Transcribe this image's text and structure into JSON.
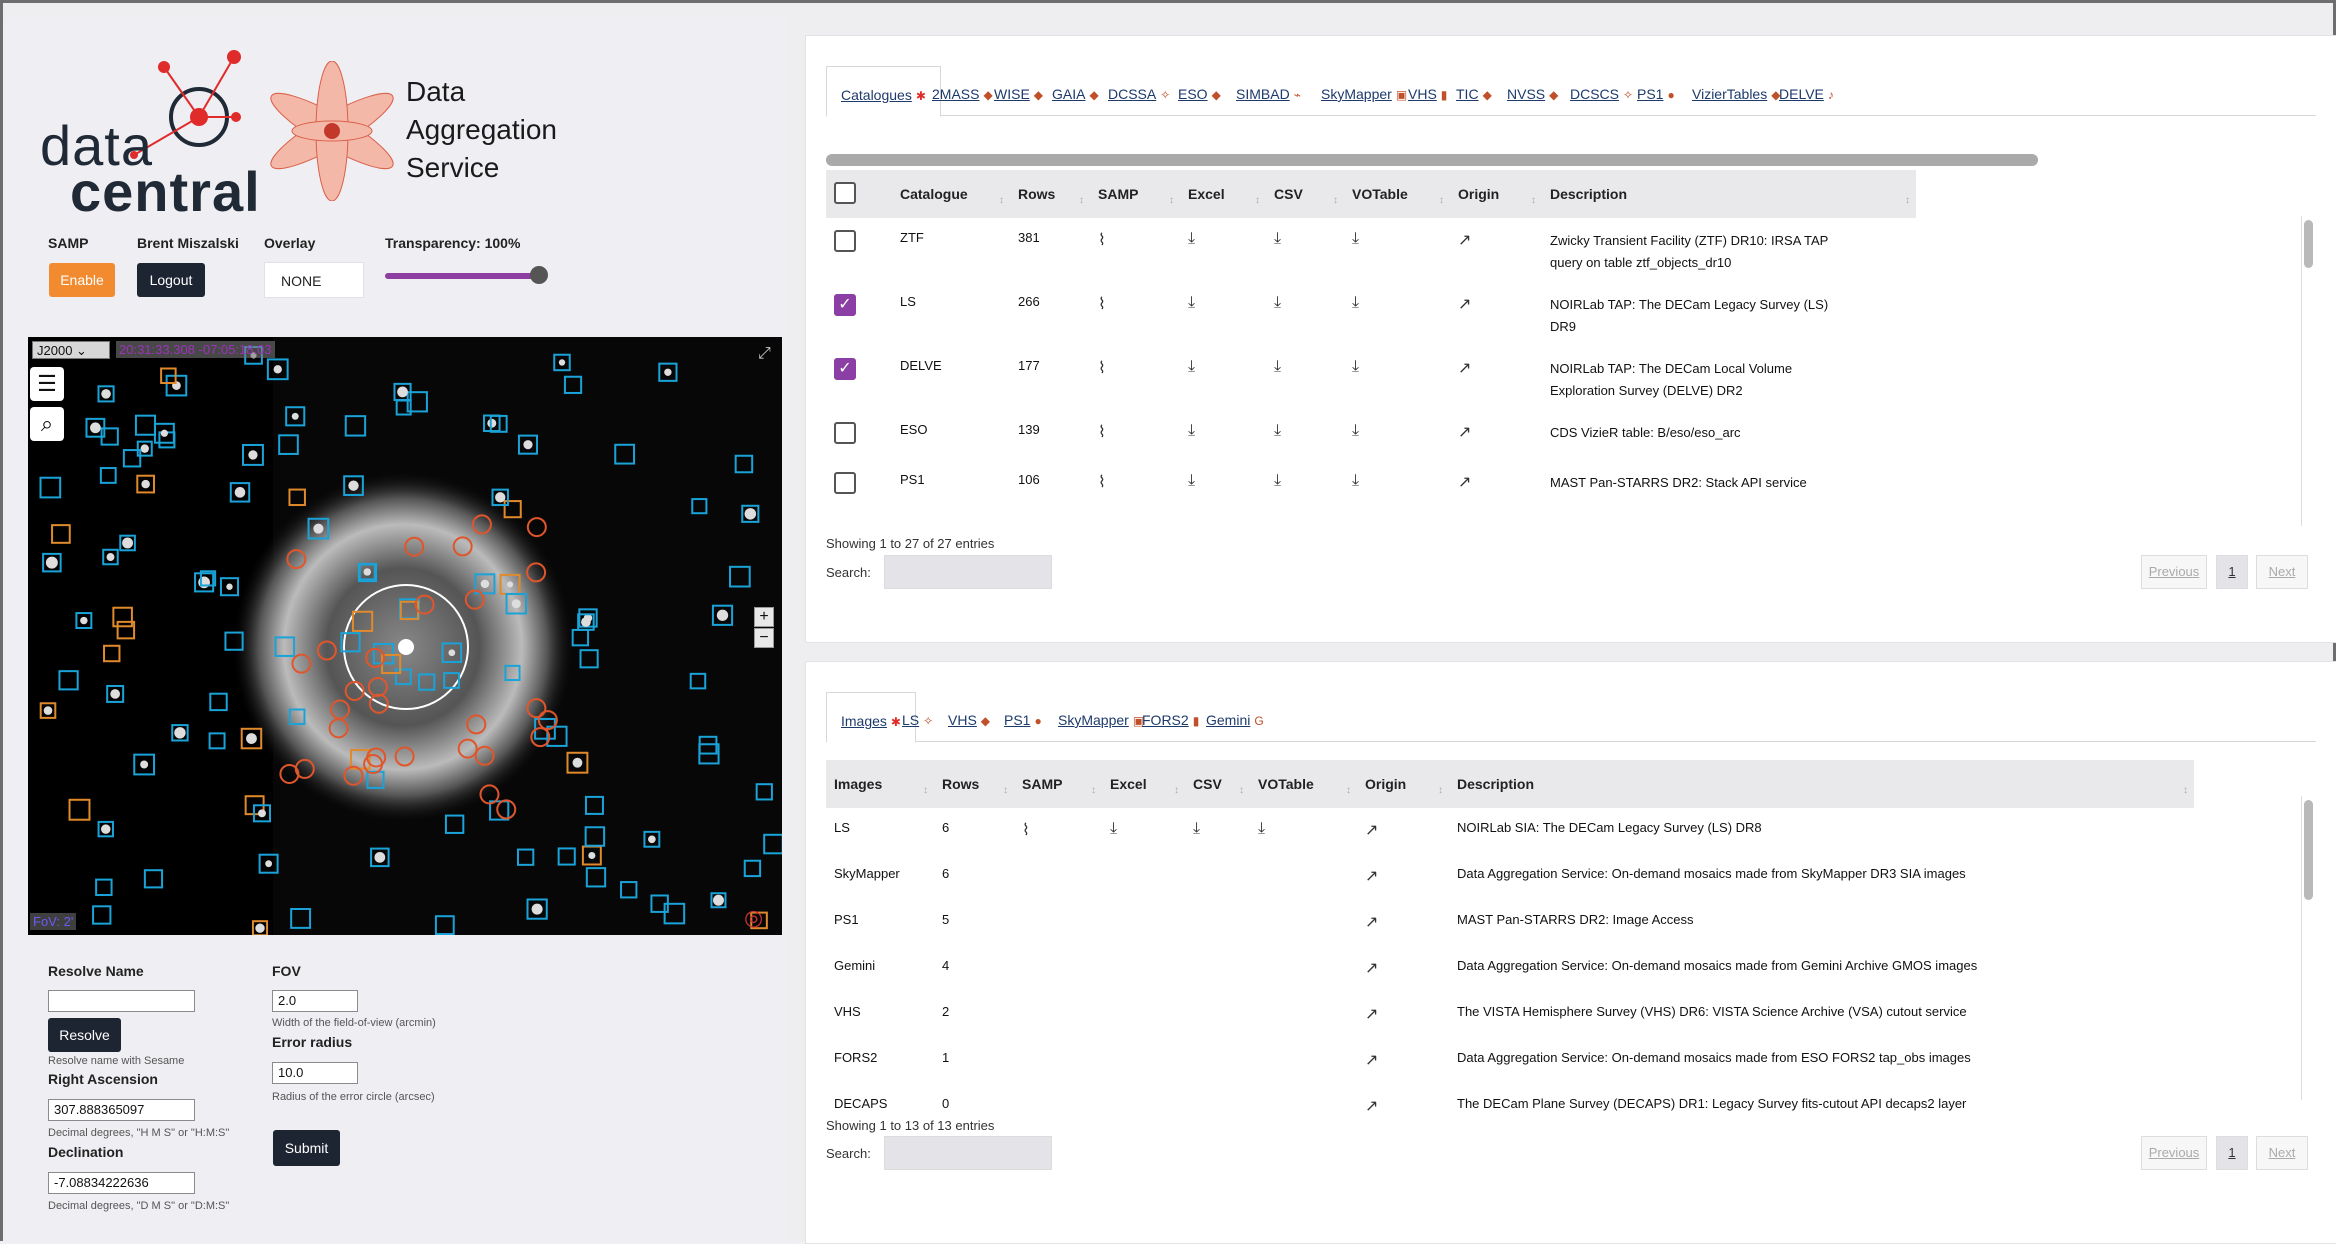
{
  "brand": {
    "logo_word1": "data",
    "logo_word2": "central",
    "service_line1": "Data",
    "service_line2": "Aggregation",
    "service_line3": "Service"
  },
  "controls": {
    "samp_label": "SAMP",
    "samp_button": "Enable",
    "user_name": "Brent Miszalski",
    "logout_button": "Logout",
    "overlay_label": "Overlay",
    "overlay_value": "NONE",
    "transparency_label": "Transparency: 100%",
    "transparency_value": 1.0
  },
  "sky": {
    "frame": "J2000",
    "coord_readout": "20:31:33.308 -07:05:18.03",
    "fov_readout": "FoV: 2'"
  },
  "form": {
    "resolve_label": "Resolve Name",
    "resolve_value": "",
    "resolve_button": "Resolve",
    "resolve_help": "Resolve name with Sesame",
    "ra_label": "Right Ascension",
    "ra_value": "307.888365097",
    "ra_help": "Decimal degrees, \"H M S\" or \"H:M:S\"",
    "dec_label": "Declination",
    "dec_value": "-7.08834222636",
    "dec_help": "Decimal degrees, \"D M S\" or \"D:M:S\"",
    "fov_label": "FOV",
    "fov_value": "2.0",
    "fov_help": "Width of the field-of-view (arcmin)",
    "err_label": "Error radius",
    "err_value": "10.0",
    "err_help": "Radius of the error circle (arcsec)",
    "submit_button": "Submit"
  },
  "catalogues": {
    "tabs": [
      "Catalogues",
      "2MASS",
      "WISE",
      "GAIA",
      "DCSSA",
      "ESO",
      "SIMBAD",
      "SkyMapper",
      "VHS",
      "TIC",
      "NVSS",
      "DCSCS",
      "PS1",
      "VizierTables",
      "DELVE"
    ],
    "columns": [
      "Catalogue",
      "Rows",
      "SAMP",
      "Excel",
      "CSV",
      "VOTable",
      "Origin",
      "Description"
    ],
    "rows": [
      {
        "checked": false,
        "name": "ZTF",
        "rows": "381",
        "desc1": "Zwicky Transient Facility (ZTF) DR10: IRSA TAP",
        "desc2": "query on table ztf_objects_dr10"
      },
      {
        "checked": true,
        "name": "LS",
        "rows": "266",
        "desc1": "NOIRLab TAP: The DECam Legacy Survey (LS)",
        "desc2": "DR9"
      },
      {
        "checked": true,
        "name": "DELVE",
        "rows": "177",
        "desc1": "NOIRLab TAP: The DECam Local Volume",
        "desc2": "Exploration Survey (DELVE) DR2"
      },
      {
        "checked": false,
        "name": "ESO",
        "rows": "139",
        "desc1": "CDS VizieR table: B/eso/eso_arc",
        "desc2": ""
      },
      {
        "checked": false,
        "name": "PS1",
        "rows": "106",
        "desc1": "MAST Pan-STARRS DR2: Stack API service",
        "desc2": ""
      }
    ],
    "info": "Showing 1 to 27 of 27 entries",
    "search_label": "Search:",
    "prev": "Previous",
    "page": "1",
    "next": "Next"
  },
  "images": {
    "tabs": [
      "Images",
      "LS",
      "VHS",
      "PS1",
      "SkyMapper",
      "FORS2",
      "Gemini"
    ],
    "columns": [
      "Images",
      "Rows",
      "SAMP",
      "Excel",
      "CSV",
      "VOTable",
      "Origin",
      "Description"
    ],
    "rows": [
      {
        "name": "LS",
        "rows": "6",
        "samp": true,
        "desc": "NOIRLab SIA: The DECam Legacy Survey (LS) DR8"
      },
      {
        "name": "SkyMapper",
        "rows": "6",
        "samp": false,
        "desc": "Data Aggregation Service: On-demand mosaics made from SkyMapper DR3 SIA images"
      },
      {
        "name": "PS1",
        "rows": "5",
        "samp": false,
        "desc": "MAST Pan-STARRS DR2: Image Access"
      },
      {
        "name": "Gemini",
        "rows": "4",
        "samp": false,
        "desc": "Data Aggregation Service: On-demand mosaics made from Gemini Archive GMOS images"
      },
      {
        "name": "VHS",
        "rows": "2",
        "samp": false,
        "desc": "The VISTA Hemisphere Survey (VHS) DR6: VISTA Science Archive (VSA) cutout service"
      },
      {
        "name": "FORS2",
        "rows": "1",
        "samp": false,
        "desc": "Data Aggregation Service: On-demand mosaics made from ESO FORS2 tap_obs images"
      },
      {
        "name": "DECAPS",
        "rows": "0",
        "samp": false,
        "desc": "The DECam Plane Survey (DECAPS) DR1: Legacy Survey fits-cutout API decaps2 layer"
      }
    ],
    "info": "Showing 1 to 13 of 13 entries",
    "search_label": "Search:",
    "prev": "Previous",
    "page": "1",
    "next": "Next"
  },
  "colors": {
    "accent": "#8b3fa5",
    "samp_button": "#f28b30",
    "dark_button": "#1d2533",
    "overlay_blue": "#1aa3d9",
    "overlay_orange": "#e0562c"
  }
}
